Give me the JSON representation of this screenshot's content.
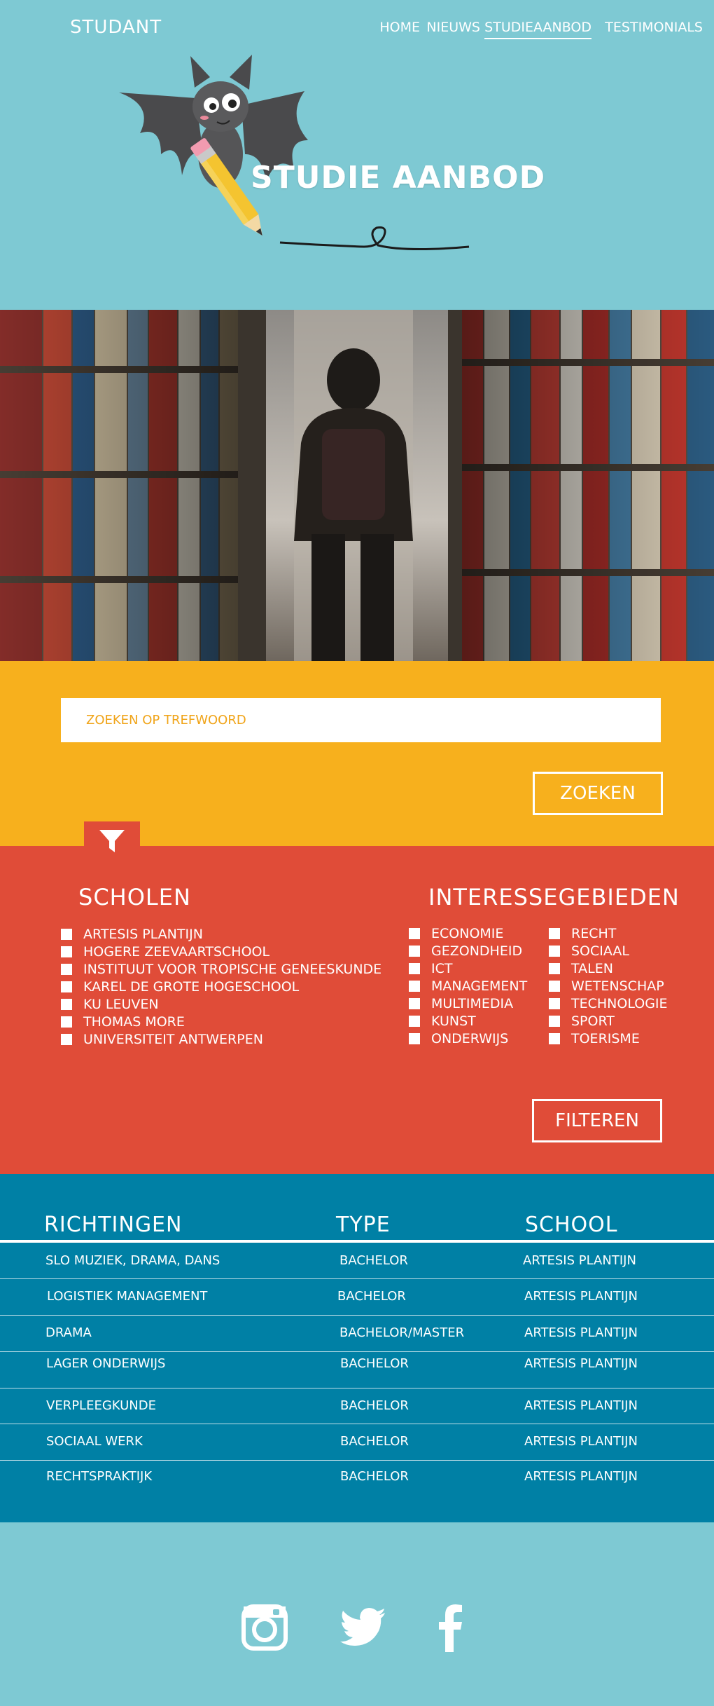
{
  "header": {
    "logo": "STUDANT",
    "nav": [
      {
        "label": "HOME",
        "active": false
      },
      {
        "label": "NIEUWS",
        "active": false
      },
      {
        "label": "STUDIEAANBOD",
        "active": true
      },
      {
        "label": "TESTIMONIALS",
        "active": false
      }
    ],
    "title": "STUDIE AANBOD"
  },
  "search": {
    "placeholder": "ZOEKEN OP TREFWOORD",
    "button": "ZOEKEN"
  },
  "filter": {
    "icon": "filter-icon",
    "schools_title": "SCHOLEN",
    "schools": [
      "ARTESIS PLANTIJN",
      "HOGERE ZEEVAARTSCHOOL",
      "INSTITUUT VOOR TROPISCHE GENEESKUNDE",
      "KAREL DE GROTE HOGESCHOOL",
      "KU LEUVEN",
      "THOMAS MORE",
      "UNIVERSITEIT ANTWERPEN"
    ],
    "interests_title": "INTERESSEGEBIEDEN",
    "interests_col1": [
      "ECONOMIE",
      "GEZONDHEID",
      "ICT",
      "MANAGEMENT",
      "MULTIMEDIA",
      "KUNST",
      "ONDERWIJS"
    ],
    "interests_col2": [
      "RECHT",
      "SOCIAAL",
      "TALEN",
      "WETENSCHAP",
      "TECHNOLOGIE",
      "SPORT",
      "TOERISME"
    ],
    "button": "FILTEREN"
  },
  "table": {
    "headers": [
      "RICHTINGEN",
      "TYPE",
      "SCHOOL"
    ],
    "rows": [
      [
        "SLO MUZIEK, DRAMA, DANS",
        "BACHELOR",
        "ARTESIS PLANTIJN"
      ],
      [
        "LOGISTIEK MANAGEMENT",
        "BACHELOR",
        "ARTESIS PLANTIJN"
      ],
      [
        "DRAMA",
        "BACHELOR/MASTER",
        "ARTESIS PLANTIJN"
      ],
      [
        "LAGER ONDERWIJS",
        "BACHELOR",
        "ARTESIS PLANTIJN"
      ],
      [
        "VERPLEEGKUNDE",
        "BACHELOR",
        "ARTESIS PLANTIJN"
      ],
      [
        "SOCIAAL WERK",
        "BACHELOR",
        "ARTESIS PLANTIJN"
      ],
      [
        "RECHTSPRAKTIJK",
        "BACHELOR",
        "ARTESIS PLANTIJN"
      ]
    ]
  },
  "footer": {
    "icons": [
      "instagram-icon",
      "twitter-icon",
      "facebook-icon"
    ]
  },
  "colors": {
    "header_bg": "#7ec9d3",
    "search_bg": "#f7b01d",
    "filter_bg": "#e04c38",
    "table_bg": "#0080a5"
  }
}
